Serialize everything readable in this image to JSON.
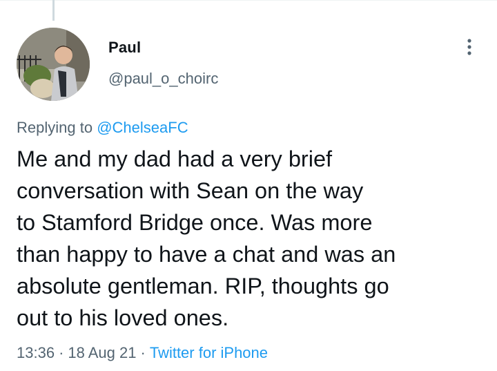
{
  "tweet": {
    "author": {
      "display_name": "Paul",
      "handle": "@paul_o_choirc",
      "avatar_icon": "profile-photo"
    },
    "replying_prefix": "Replying to",
    "replying_to": "@ChelseaFC",
    "text_lines": [
      "Me and my dad had a very brief",
      "conversation with Sean on the way",
      "to Stamford Bridge once. Was more",
      "than happy to have a chat and was an",
      "absolute gentleman. RIP, thoughts go",
      "out to his loved ones."
    ],
    "time": "13:36",
    "date": "18 Aug 21",
    "separator": "·",
    "source": "Twitter for iPhone",
    "more_icon": "more-vertical-icon"
  },
  "colors": {
    "text": "#0f1419",
    "secondary": "#536471",
    "link": "#1d9bf0",
    "thread_line": "#cfd9de"
  }
}
